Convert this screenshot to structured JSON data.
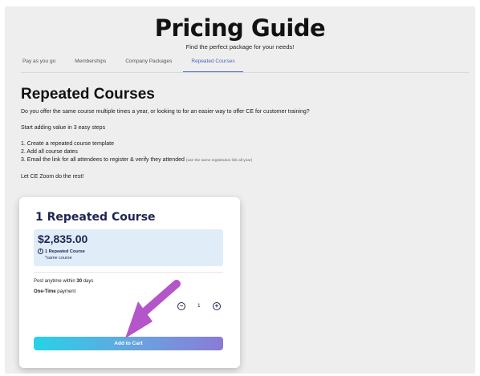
{
  "header": {
    "title": "Pricing Guide",
    "subtitle": "Find the perfect package for your needs!"
  },
  "tabs": [
    {
      "label": "Pay as you go",
      "active": false
    },
    {
      "label": "Memberships",
      "active": false
    },
    {
      "label": "Company Packages",
      "active": false
    },
    {
      "label": "Repeated Courses",
      "active": true
    }
  ],
  "section": {
    "heading": "Repeated Courses",
    "intro": "Do you offer the same course multiple times a year, or looking to for an easier way to offer CE for customer training?",
    "steps_intro": "Start adding value in 3 easy steps",
    "steps": [
      "1. Create a repeated course template",
      "2. Add all course dates",
      "3. Email the link for all attendees to register & verify they attended"
    ],
    "step3_note": "(use the same registration link all year)",
    "closing": "Let CE Zoom do the rest!"
  },
  "card": {
    "title": "1 Repeated Course",
    "price": "$2,835.00",
    "info_icon": "info-circle-icon",
    "detail": "1 Repeated Course",
    "detail_sub": "*same course",
    "post_prefix": "Post anytime within ",
    "post_days": "30",
    "post_suffix": " days",
    "payment_type": "One-Time",
    "payment_suffix": " payment",
    "quantity": "1",
    "minus_icon": "minus-circle-icon",
    "plus_icon": "plus-circle-icon",
    "add_to_cart": "Add to Cart"
  },
  "colors": {
    "accent_tab": "#4a63c9",
    "card_title": "#1f2552",
    "price_box": "#e0edf9",
    "arrow": "#b455c9",
    "button_gradient_start": "#27d2e6",
    "button_gradient_end": "#8a7bd6"
  }
}
